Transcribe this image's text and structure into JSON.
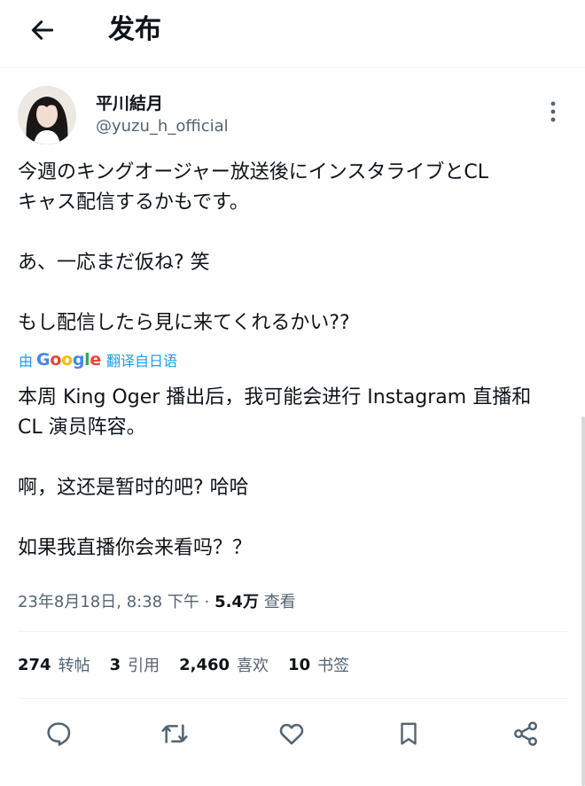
{
  "header": {
    "title": "发布"
  },
  "author": {
    "display_name": "平川結月",
    "handle": "@yuzu_h_official"
  },
  "tweet": {
    "text": "今週のキングオージャー放送後にインスタライブとCL\nキャス配信するかもです。\n\nあ、一応まだ仮ね? 笑\n\nもし配信したら見に来てくれるかい??"
  },
  "translation": {
    "prefix": "由",
    "provider": "Google",
    "suffix": "翻译自日语",
    "text": "本周 King Oger 播出后，我可能会进行 Instagram 直播和\nCL 演员阵容。\n\n啊，这还是暂时的吧? 哈哈\n\n如果我直播你会来看吗？？"
  },
  "meta": {
    "datetime": "23年8月18日, 8:38 下午",
    "separator": "·",
    "views_count": "5.4万",
    "views_label": "查看"
  },
  "stats": [
    {
      "count": "274",
      "label": "转帖"
    },
    {
      "count": "3",
      "label": "引用"
    },
    {
      "count": "2,460",
      "label": "喜欢"
    },
    {
      "count": "10",
      "label": "书签"
    }
  ],
  "colors": {
    "accent": "#1d9bf0",
    "text": "#0f1419",
    "secondary": "#536471",
    "divider": "#eff3f4"
  },
  "icons": [
    "back-arrow-icon",
    "more-vertical-icon",
    "reply-icon",
    "repost-icon",
    "like-icon",
    "bookmark-icon",
    "share-icon"
  ]
}
